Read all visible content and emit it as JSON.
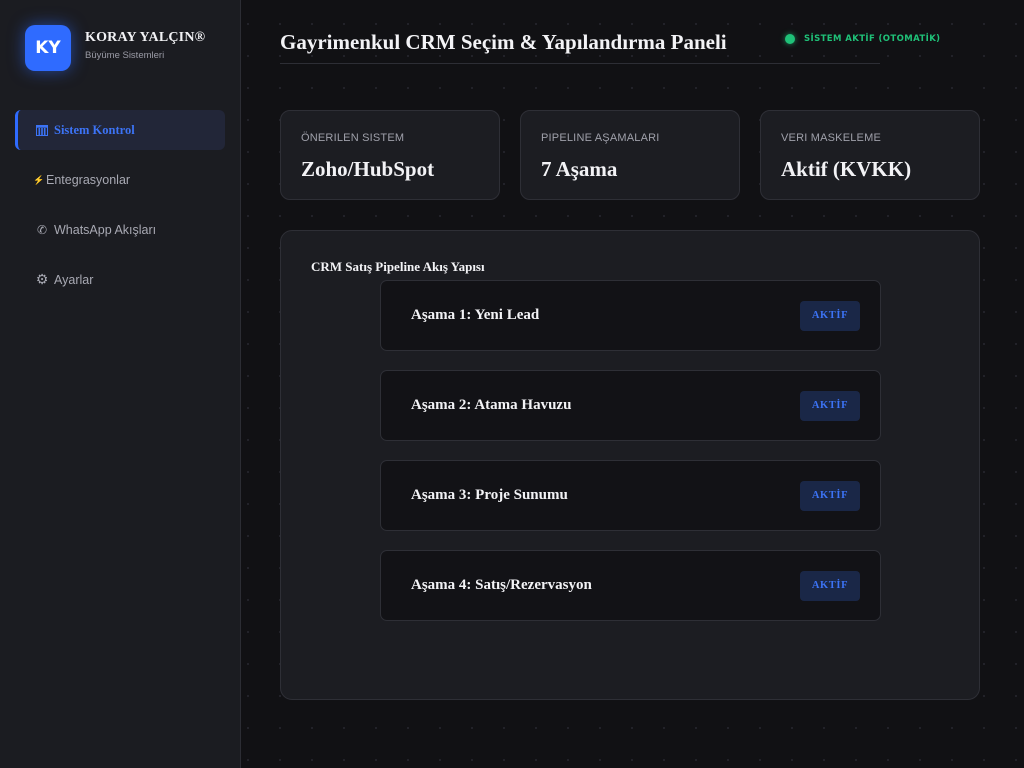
{
  "brand": {
    "initials": "KY",
    "name": "KORAY YALÇIN®",
    "subtitle": "Büyüme Sistemleri"
  },
  "sidebar": {
    "items": [
      {
        "label": "Sistem Kontrol",
        "icon": "columns-icon",
        "glyph": "▥",
        "active": true
      },
      {
        "label": "Entegrasyonlar",
        "icon": "lightning-icon",
        "glyph": "⚡",
        "active": false
      },
      {
        "label": "WhatsApp Akışları",
        "icon": "phone-icon",
        "glyph": "✆",
        "active": false
      },
      {
        "label": "Ayarlar",
        "icon": "gear-icon",
        "glyph": "⚙",
        "active": false
      }
    ]
  },
  "header": {
    "title": "Gayrimenkul CRM Seçim & Yapılandırma Paneli",
    "status": "SİSTEM AKTİF (OTOMATİK)"
  },
  "stats": [
    {
      "label": "ÖNERILEN SISTEM",
      "value": "Zoho/HubSpot"
    },
    {
      "label": "PIPELINE AŞAMALARI",
      "value": "7 Aşama"
    },
    {
      "label": "VERI MASKELEME",
      "value": "Aktif (KVKK)"
    }
  ],
  "pipeline": {
    "title": "CRM Satış Pipeline Akış Yapısı",
    "stages": [
      {
        "name": "Aşama 1: Yeni Lead",
        "badge": "AKTİF"
      },
      {
        "name": "Aşama 2: Atama Havuzu",
        "badge": "AKTİF"
      },
      {
        "name": "Aşama 3: Proje Sunumu",
        "badge": "AKTİF"
      },
      {
        "name": "Aşama 4: Satış/Rezervasyon",
        "badge": "AKTİF"
      }
    ]
  },
  "colors": {
    "accent": "#2f6bff",
    "status": "#1fc178",
    "background": "#111114",
    "panel": "#1c1d22"
  }
}
